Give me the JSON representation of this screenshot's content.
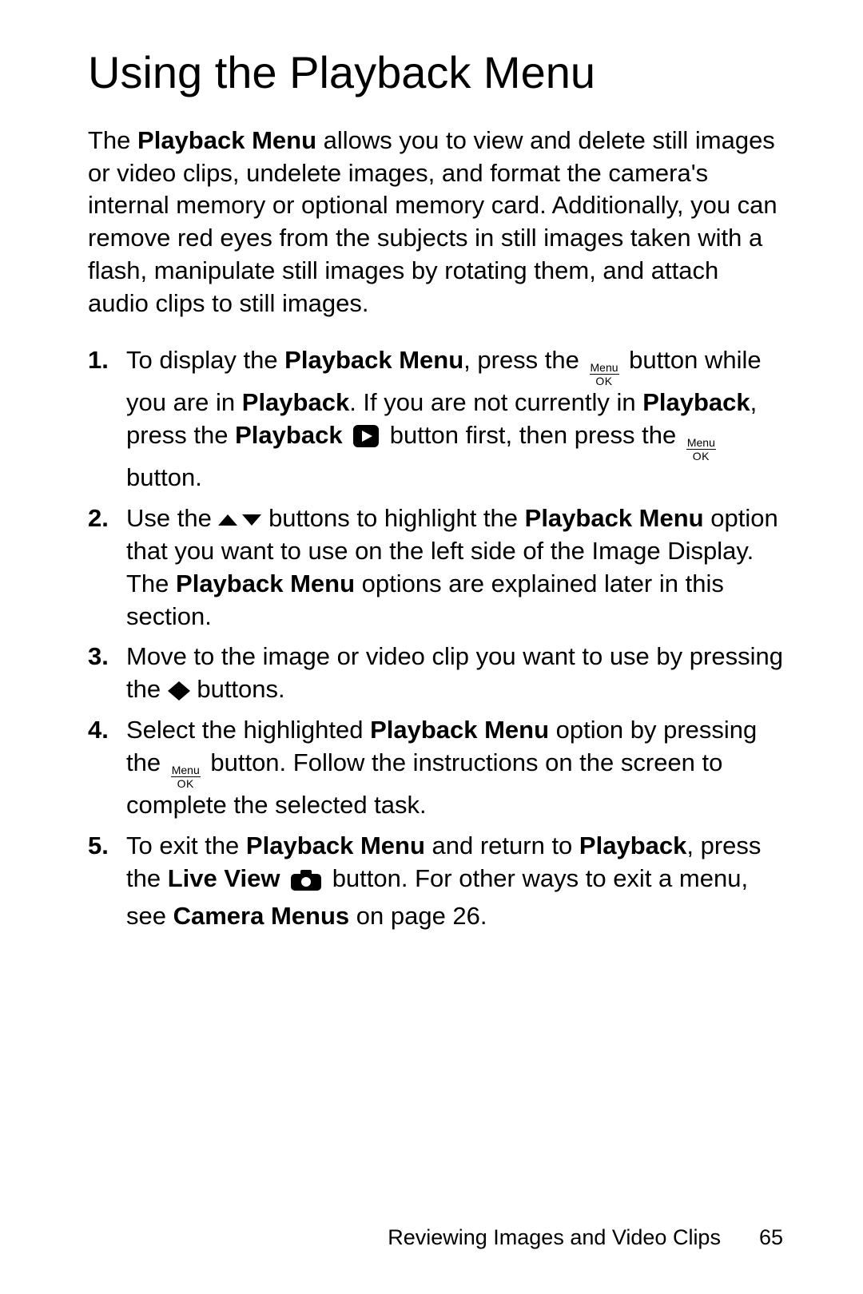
{
  "title": "Using the Playback Menu",
  "intro": {
    "txt1": "The ",
    "bold1": "Playback Menu",
    "txt2": " allows you to view and delete still images or video clips, undelete images, and format the camera's internal memory or optional memory card. Additionally, you can remove red eyes from the subjects in still images taken with a flash, manipulate still images by rotating them, and attach audio clips to still images."
  },
  "icons": {
    "menu_label_top": "Menu",
    "menu_label_bot": "OK"
  },
  "steps": {
    "s1": {
      "a": "To display the ",
      "b": "Playback Menu",
      "c": ", press the ",
      "d": " button while you are in ",
      "e": "Playback",
      "f": ". If you are not currently in ",
      "g": "Playback",
      "h": ", press the ",
      "i": "Playback",
      "j": " button first, then press the ",
      "k": " button."
    },
    "s2": {
      "a": "Use the ",
      "b": " buttons to highlight the ",
      "c": "Playback Menu",
      "d": " option that you want to use on the left side of the Image Display. The ",
      "e": "Playback Menu",
      "f": " options are explained later in this section."
    },
    "s3": {
      "a": "Move to the image or video clip you want to use by pressing the ",
      "b": " buttons."
    },
    "s4": {
      "a": "Select the highlighted ",
      "b": "Playback Menu",
      "c": " option by pressing the ",
      "d": " button. Follow the instructions on the screen to complete the selected task."
    },
    "s5": {
      "a": "To exit the ",
      "b": "Playback Menu",
      "c": " and return to ",
      "d": "Playback",
      "e": ", press the ",
      "f": "Live View",
      "g": " button. For other ways to exit a menu, see ",
      "h": "Camera Menus",
      "i": " on page 26."
    }
  },
  "footer": {
    "chapter": "Reviewing Images and Video Clips",
    "page": "65"
  }
}
